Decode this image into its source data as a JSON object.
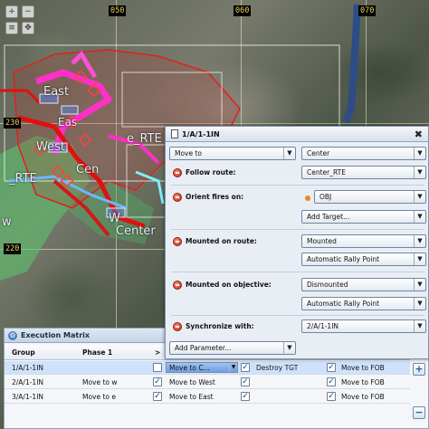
{
  "map": {
    "grid_labels_top": [
      "050",
      "060",
      "070"
    ],
    "grid_labels_left": [
      "230",
      "220"
    ],
    "unit_labels": [
      "East",
      "Eas",
      "West",
      "Cen",
      "e_RTE",
      "_RTE",
      "W",
      "Center",
      "w"
    ],
    "tool_icons": [
      "zoom-in-icon",
      "zoom-out-icon",
      "layers-icon",
      "pan-icon"
    ]
  },
  "dialog": {
    "title": "1/A/1-1IN",
    "close_glyph": "✖",
    "action_select": "Move to",
    "action_target": "Center",
    "follow_route_label": "Follow route:",
    "follow_route_value": "Center_RTE",
    "orient_fires_label": "Orient fires on:",
    "orient_fires_value": "OBJ",
    "add_target_label": "Add Target...",
    "mounted_route_label": "Mounted on route:",
    "mounted_route_value": "Mounted",
    "mounted_route_rally": "Automatic Rally Point",
    "mounted_objective_label": "Mounted on objective:",
    "mounted_objective_value": "Dismounted",
    "mounted_objective_rally": "Automatic Rally Point",
    "synchronize_label": "Synchronize with:",
    "synchronize_value": "2/A/1-1IN",
    "add_parameter_label": "Add Parameter..."
  },
  "matrix": {
    "title": "Execution Matrix",
    "columns": [
      "Group",
      "Phase 1",
      ">"
    ],
    "rows": [
      {
        "group": "1/A/1-1IN",
        "phase1": "",
        "task1": "Move to C...",
        "task2": "Destroy TGT",
        "task3": "Move to FOB",
        "selected": true
      },
      {
        "group": "2/A/1-1IN",
        "phase1": "Move to w",
        "task1": "Move to West",
        "task2": "",
        "task3": "Move to FOB",
        "selected": false
      },
      {
        "group": "3/A/1-1IN",
        "phase1": "Move to e",
        "task1": "Move to East",
        "task2": "",
        "task3": "Move to FOB",
        "selected": false
      }
    ],
    "add_button": "+",
    "remove_button": "−"
  }
}
